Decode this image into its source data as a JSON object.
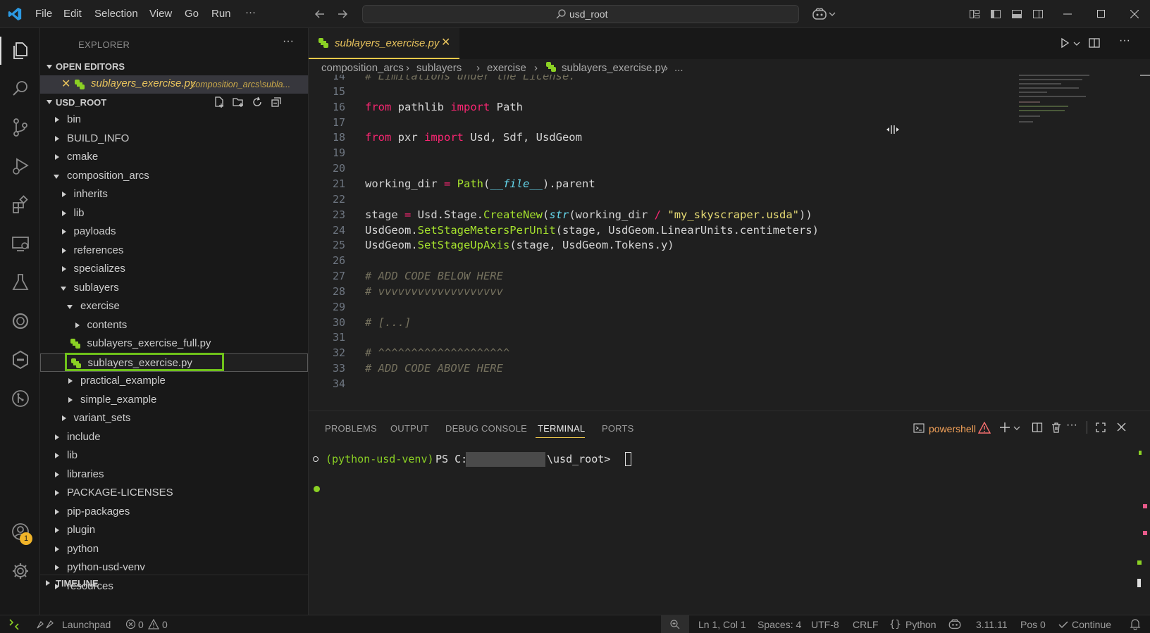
{
  "titlebar": {
    "menu": [
      "File",
      "Edit",
      "Selection",
      "View",
      "Go",
      "Run",
      "···"
    ],
    "search_text": "usd_root"
  },
  "sidebar": {
    "header": "EXPLORER",
    "open_editors_label": "OPEN EDITORS",
    "open_editor": {
      "name": "sublayers_exercise.py",
      "path": "composition_arcs\\subla..."
    },
    "root_label": "USD_ROOT",
    "tree": [
      {
        "label": "bin",
        "depth": 0,
        "kind": "folder",
        "open": false
      },
      {
        "label": "BUILD_INFO",
        "depth": 0,
        "kind": "folder",
        "open": false
      },
      {
        "label": "cmake",
        "depth": 0,
        "kind": "folder",
        "open": false
      },
      {
        "label": "composition_arcs",
        "depth": 0,
        "kind": "folder",
        "open": true
      },
      {
        "label": "inherits",
        "depth": 1,
        "kind": "folder",
        "open": false
      },
      {
        "label": "lib",
        "depth": 1,
        "kind": "folder",
        "open": false
      },
      {
        "label": "payloads",
        "depth": 1,
        "kind": "folder",
        "open": false
      },
      {
        "label": "references",
        "depth": 1,
        "kind": "folder",
        "open": false
      },
      {
        "label": "specializes",
        "depth": 1,
        "kind": "folder",
        "open": false
      },
      {
        "label": "sublayers",
        "depth": 1,
        "kind": "folder",
        "open": true
      },
      {
        "label": "exercise",
        "depth": 2,
        "kind": "folder",
        "open": true
      },
      {
        "label": "contents",
        "depth": 3,
        "kind": "folder",
        "open": false
      },
      {
        "label": "sublayers_exercise_full.py",
        "depth": 3,
        "kind": "file",
        "open": false
      },
      {
        "label": "sublayers_exercise.py",
        "depth": 3,
        "kind": "file",
        "open": false,
        "selected": true
      },
      {
        "label": "practical_example",
        "depth": 2,
        "kind": "folder",
        "open": false
      },
      {
        "label": "simple_example",
        "depth": 2,
        "kind": "folder",
        "open": false
      },
      {
        "label": "variant_sets",
        "depth": 1,
        "kind": "folder",
        "open": false
      },
      {
        "label": "include",
        "depth": 0,
        "kind": "folder",
        "open": false
      },
      {
        "label": "lib",
        "depth": 0,
        "kind": "folder",
        "open": false
      },
      {
        "label": "libraries",
        "depth": 0,
        "kind": "folder",
        "open": false
      },
      {
        "label": "PACKAGE-LICENSES",
        "depth": 0,
        "kind": "folder",
        "open": false
      },
      {
        "label": "pip-packages",
        "depth": 0,
        "kind": "folder",
        "open": false
      },
      {
        "label": "plugin",
        "depth": 0,
        "kind": "folder",
        "open": false
      },
      {
        "label": "python",
        "depth": 0,
        "kind": "folder",
        "open": false
      },
      {
        "label": "python-usd-venv",
        "depth": 0,
        "kind": "folder",
        "open": false
      },
      {
        "label": "resources",
        "depth": 0,
        "kind": "folder",
        "open": false
      }
    ],
    "timeline_label": "TIMELINE",
    "accounts_badge": "1"
  },
  "editor": {
    "tab_label": "sublayers_exercise.py",
    "breadcrumbs": [
      "composition_arcs",
      "sublayers",
      "exercise",
      "sublayers_exercise.py",
      "..."
    ],
    "lines": [
      {
        "n": "14",
        "html": "<span class='cm'># Limitations under the License.</span>"
      },
      {
        "n": "15",
        "html": ""
      },
      {
        "n": "16",
        "html": "<span class='kw'>from</span> pathlib <span class='kw'>import</span> Path"
      },
      {
        "n": "17",
        "html": ""
      },
      {
        "n": "18",
        "html": "<span class='kw'>from</span> pxr <span class='kw'>import</span> Usd, Sdf, UsdGeom"
      },
      {
        "n": "19",
        "html": ""
      },
      {
        "n": "20",
        "html": ""
      },
      {
        "n": "21",
        "html": "working_dir <span class='op'>=</span> <span class='fn'>Path</span>(<span class='builtin'>__file__</span>).parent"
      },
      {
        "n": "22",
        "html": ""
      },
      {
        "n": "23",
        "html": "stage <span class='op'>=</span> Usd.Stage.<span class='fn'>CreateNew</span>(<span class='builtin'>str</span>(working_dir <span class='op'>/</span> <span class='str'>\"my_skyscraper.usda\"</span>))"
      },
      {
        "n": "24",
        "html": "UsdGeom.<span class='fn'>SetStageMetersPerUnit</span>(stage, UsdGeom.LinearUnits.centimeters)"
      },
      {
        "n": "25",
        "html": "UsdGeom.<span class='fn'>SetStageUpAxis</span>(stage, UsdGeom.Tokens.y)"
      },
      {
        "n": "26",
        "html": ""
      },
      {
        "n": "27",
        "html": "<span class='cm'># ADD CODE BELOW HERE</span>"
      },
      {
        "n": "28",
        "html": "<span class='cm'># vvvvvvvvvvvvvvvvvvv</span>"
      },
      {
        "n": "29",
        "html": ""
      },
      {
        "n": "30",
        "html": "<span class='cm'># [...]</span>"
      },
      {
        "n": "31",
        "html": ""
      },
      {
        "n": "32",
        "html": "<span class='cm'># ^^^^^^^^^^^^^^^^^^^^</span>"
      },
      {
        "n": "33",
        "html": "<span class='cm'># ADD CODE ABOVE HERE</span>"
      },
      {
        "n": "34",
        "html": ""
      }
    ]
  },
  "panel": {
    "tabs": [
      "PROBLEMS",
      "OUTPUT",
      "DEBUG CONSOLE",
      "TERMINAL",
      "PORTS"
    ],
    "active_tab": "TERMINAL",
    "shell_label": "powershell",
    "prompt_env": "(python-usd-venv)",
    "prompt_ps": "PS C:",
    "prompt_path": "\\usd_root>"
  },
  "statusbar": {
    "remote": "Launchpad",
    "errors": "0",
    "warnings": "0",
    "position": "Ln 1, Col 1",
    "spaces": "Spaces: 4",
    "encoding": "UTF-8",
    "eol": "CRLF",
    "language": "Python",
    "python_version": "3.11.11",
    "pos": "Pos 0",
    "continue": "Continue"
  },
  "colors": {
    "accent_yellow": "#f0c94b",
    "highlight_green": "#6fc21a",
    "python_green": "#8bd124"
  }
}
